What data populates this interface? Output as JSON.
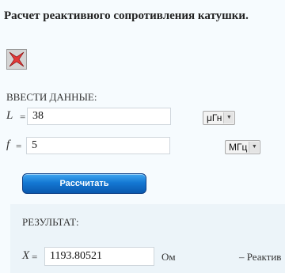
{
  "title": "Расчет реактивного сопротивления катушки.",
  "input_section": {
    "label": "ВВЕСТИ ДАННЫЕ:",
    "inductance": {
      "symbol": "L",
      "equals": "=",
      "value": "38",
      "unit": "μГн"
    },
    "frequency": {
      "symbol": "f",
      "equals": "=",
      "value": "5",
      "unit": "МГц"
    }
  },
  "calculate_button": "Рассчитать",
  "result_section": {
    "label": "РЕЗУЛЬТАТ:",
    "reactance": {
      "symbol": "X",
      "equals": "=",
      "value": "1193.80521",
      "unit": "Ом",
      "note": "– Реактив"
    }
  }
}
